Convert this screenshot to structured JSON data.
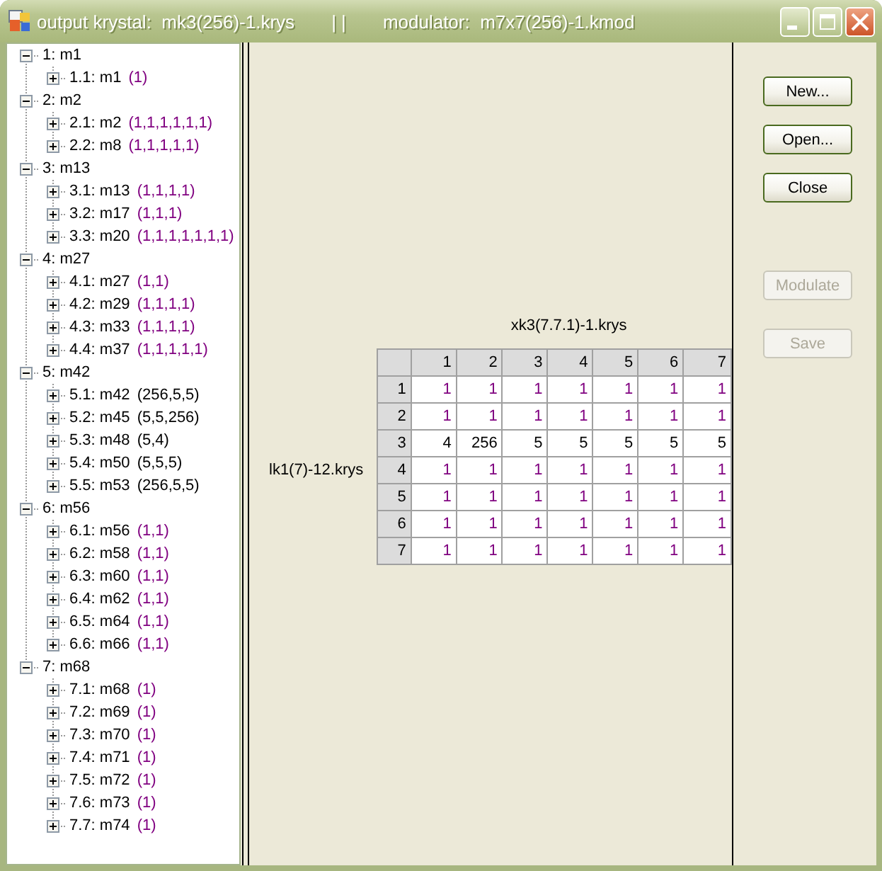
{
  "window": {
    "title": "output krystal:  mk3(256)-1.krys",
    "separator": "| |",
    "subtitle": "modulator:  m7x7(256)-1.kmod"
  },
  "tree": [
    {
      "label": "1: m1",
      "expanded": true,
      "children": [
        {
          "label": "1.1: m1",
          "count": "(1)",
          "color": "#800080",
          "expanded": false
        }
      ]
    },
    {
      "label": "2: m2",
      "expanded": true,
      "children": [
        {
          "label": "2.1: m2",
          "count": "(1,1,1,1,1,1)",
          "color": "#800080",
          "expanded": false
        },
        {
          "label": "2.2: m8",
          "count": "(1,1,1,1,1)",
          "color": "#800080",
          "expanded": false
        }
      ]
    },
    {
      "label": "3: m13",
      "expanded": true,
      "children": [
        {
          "label": "3.1: m13",
          "count": "(1,1,1,1)",
          "color": "#800080",
          "expanded": false
        },
        {
          "label": "3.2: m17",
          "count": "(1,1,1)",
          "color": "#800080",
          "expanded": false
        },
        {
          "label": "3.3: m20",
          "count": "(1,1,1,1,1,1,1)",
          "color": "#800080",
          "expanded": false
        }
      ]
    },
    {
      "label": "4: m27",
      "expanded": true,
      "children": [
        {
          "label": "4.1: m27",
          "count": "(1,1)",
          "color": "#800080",
          "expanded": false
        },
        {
          "label": "4.2: m29",
          "count": "(1,1,1,1)",
          "color": "#800080",
          "expanded": false
        },
        {
          "label": "4.3: m33",
          "count": "(1,1,1,1)",
          "color": "#800080",
          "expanded": false
        },
        {
          "label": "4.4: m37",
          "count": "(1,1,1,1,1)",
          "color": "#800080",
          "expanded": false
        }
      ]
    },
    {
      "label": "5: m42",
      "expanded": true,
      "children": [
        {
          "label": "5.1: m42",
          "count": "(256,5,5)",
          "color": "#000000",
          "expanded": false
        },
        {
          "label": "5.2: m45",
          "count": "(5,5,256)",
          "color": "#000000",
          "expanded": false
        },
        {
          "label": "5.3: m48",
          "count": "(5,4)",
          "color": "#000000",
          "expanded": false
        },
        {
          "label": "5.4: m50",
          "count": "(5,5,5)",
          "color": "#000000",
          "expanded": false
        },
        {
          "label": "5.5: m53",
          "count": "(256,5,5)",
          "color": "#000000",
          "expanded": false
        }
      ]
    },
    {
      "label": "6: m56",
      "expanded": true,
      "children": [
        {
          "label": "6.1: m56",
          "count": "(1,1)",
          "color": "#800080",
          "expanded": false
        },
        {
          "label": "6.2: m58",
          "count": "(1,1)",
          "color": "#800080",
          "expanded": false
        },
        {
          "label": "6.3: m60",
          "count": "(1,1)",
          "color": "#800080",
          "expanded": false
        },
        {
          "label": "6.4: m62",
          "count": "(1,1)",
          "color": "#800080",
          "expanded": false
        },
        {
          "label": "6.5: m64",
          "count": "(1,1)",
          "color": "#800080",
          "expanded": false
        },
        {
          "label": "6.6: m66",
          "count": "(1,1)",
          "color": "#800080",
          "expanded": false
        }
      ]
    },
    {
      "label": "7: m68",
      "expanded": true,
      "children": [
        {
          "label": "7.1: m68",
          "count": "(1)",
          "color": "#800080",
          "expanded": false
        },
        {
          "label": "7.2: m69",
          "count": "(1)",
          "color": "#800080",
          "expanded": false
        },
        {
          "label": "7.3: m70",
          "count": "(1)",
          "color": "#800080",
          "expanded": false
        },
        {
          "label": "7.4: m71",
          "count": "(1)",
          "color": "#800080",
          "expanded": false
        },
        {
          "label": "7.5: m72",
          "count": "(1)",
          "color": "#800080",
          "expanded": false
        },
        {
          "label": "7.6: m73",
          "count": "(1)",
          "color": "#800080",
          "expanded": false
        },
        {
          "label": "7.7: m74",
          "count": "(1)",
          "color": "#800080",
          "expanded": false
        }
      ]
    }
  ],
  "grid": {
    "column_title": "xk3(7.7.1)-1.krys",
    "row_title": "lk1(7)-12.krys",
    "columns": [
      "1",
      "2",
      "3",
      "4",
      "5",
      "6",
      "7"
    ],
    "rows": [
      {
        "header": "1",
        "color": "#800080",
        "cells": [
          "1",
          "1",
          "1",
          "1",
          "1",
          "1",
          "1"
        ]
      },
      {
        "header": "2",
        "color": "#800080",
        "cells": [
          "1",
          "1",
          "1",
          "1",
          "1",
          "1",
          "1"
        ]
      },
      {
        "header": "3",
        "color": "#000000",
        "cells": [
          "4",
          "256",
          "5",
          "5",
          "5",
          "5",
          "5"
        ]
      },
      {
        "header": "4",
        "color": "#800080",
        "cells": [
          "1",
          "1",
          "1",
          "1",
          "1",
          "1",
          "1"
        ]
      },
      {
        "header": "5",
        "color": "#800080",
        "cells": [
          "1",
          "1",
          "1",
          "1",
          "1",
          "1",
          "1"
        ]
      },
      {
        "header": "6",
        "color": "#800080",
        "cells": [
          "1",
          "1",
          "1",
          "1",
          "1",
          "1",
          "1"
        ]
      },
      {
        "header": "7",
        "color": "#800080",
        "cells": [
          "1",
          "1",
          "1",
          "1",
          "1",
          "1",
          "1"
        ]
      }
    ]
  },
  "buttons": [
    {
      "label": "New...",
      "disabled": false
    },
    {
      "label": "Open...",
      "disabled": false
    },
    {
      "label": "Close",
      "disabled": false
    },
    {
      "label": "Modulate",
      "disabled": true
    },
    {
      "label": "Save",
      "disabled": true
    }
  ]
}
